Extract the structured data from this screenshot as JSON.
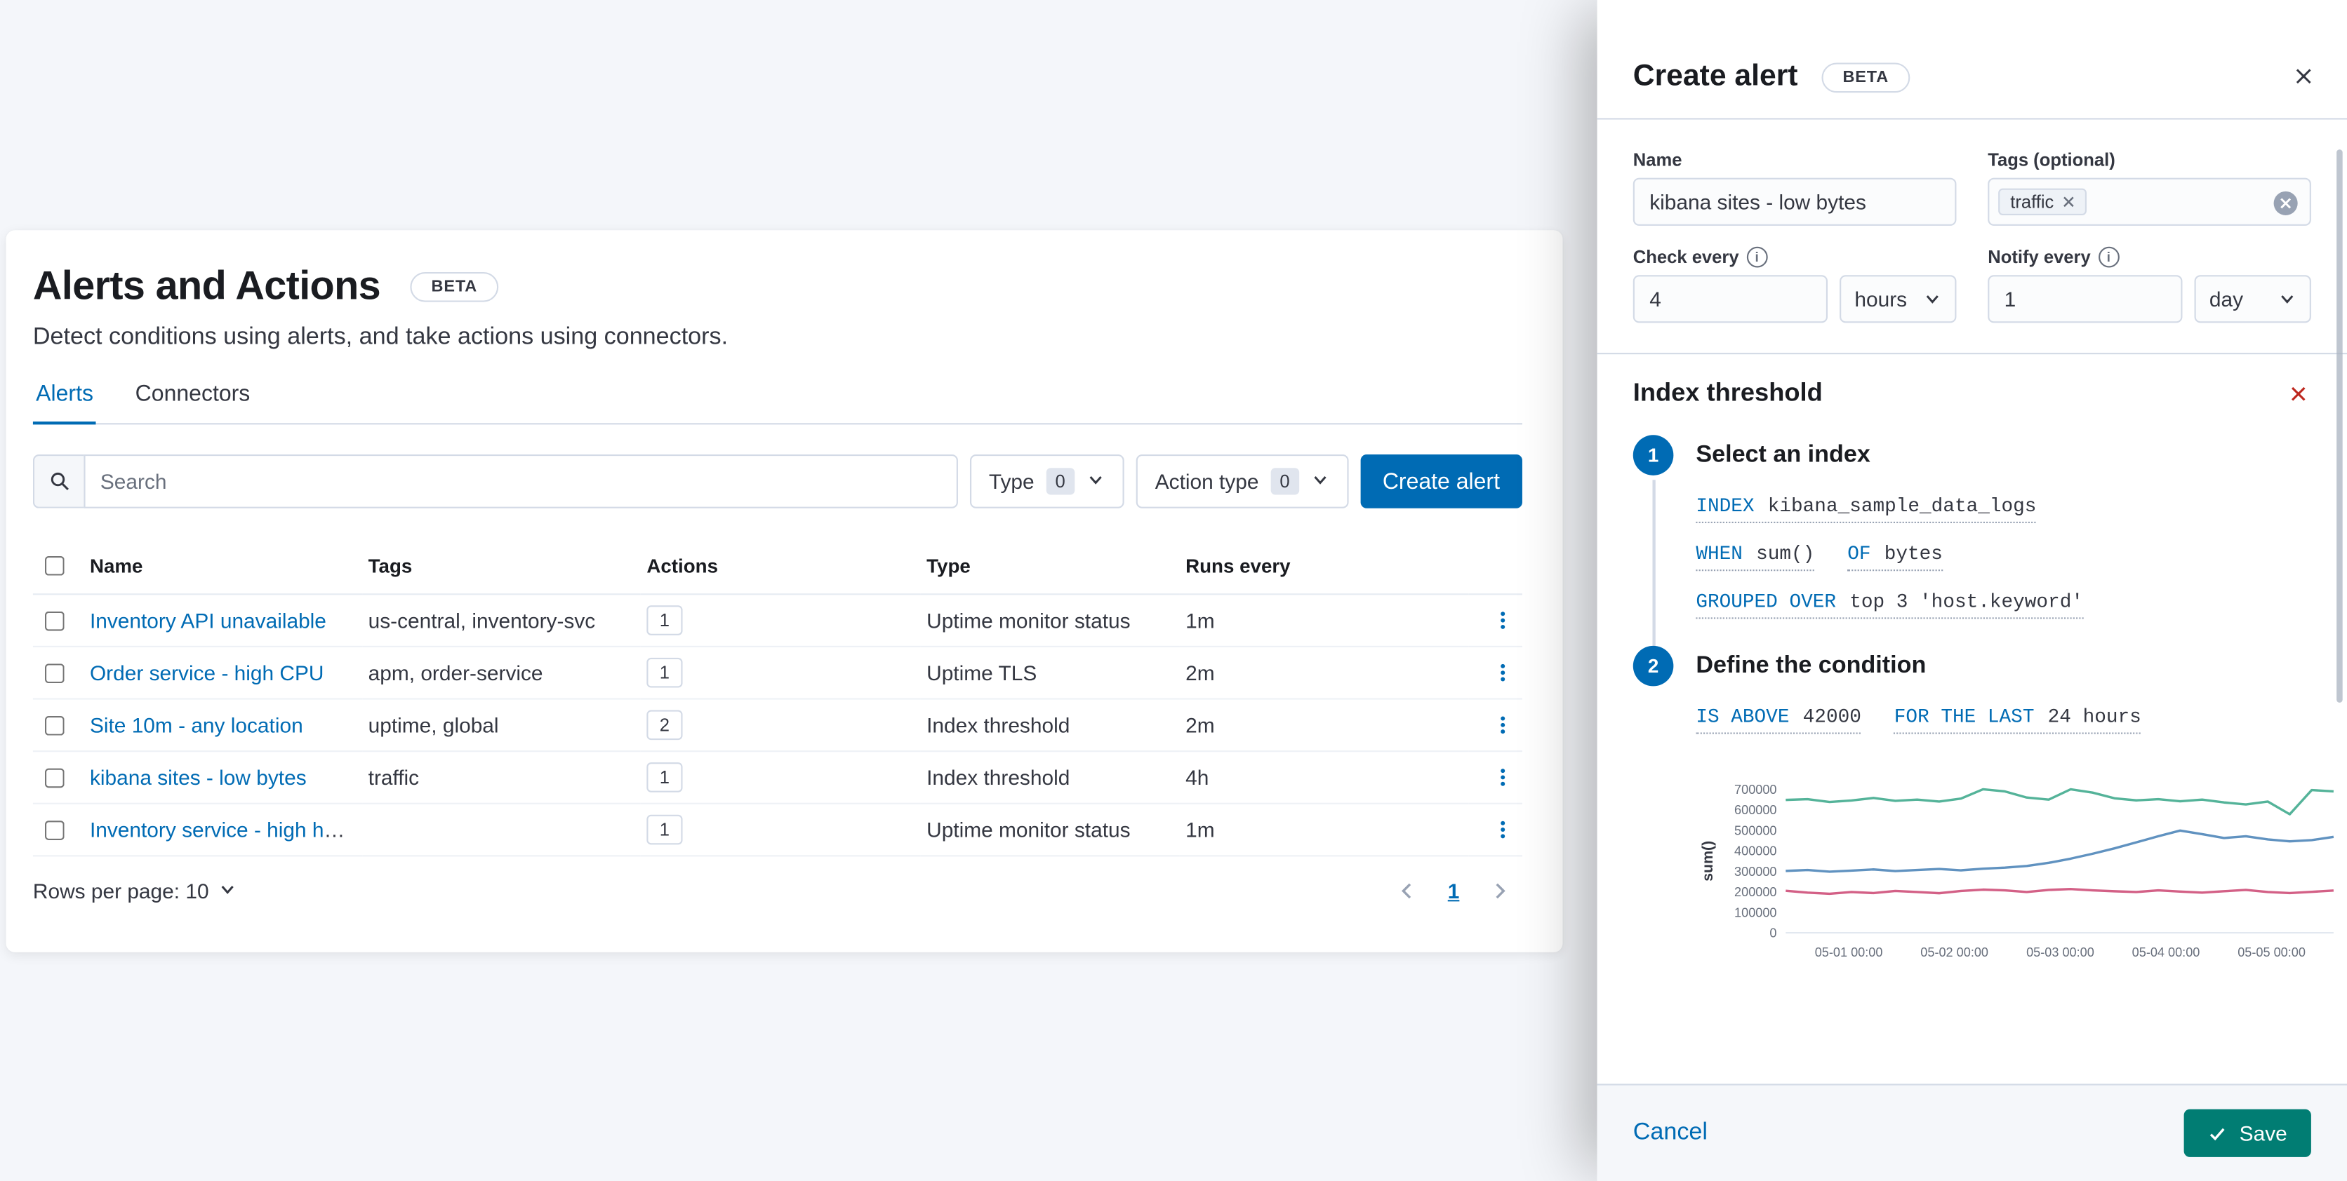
{
  "colors": {
    "primary": "#006BB4",
    "save_button": "#017D73",
    "danger": "#BD271E",
    "link": "#006BB4"
  },
  "page": {
    "title": "Alerts and Actions",
    "beta_badge": "BETA",
    "subtitle": "Detect conditions using alerts, and take actions using connectors.",
    "tabs": [
      {
        "label": "Alerts",
        "active": true
      },
      {
        "label": "Connectors",
        "active": false
      }
    ],
    "toolbar": {
      "search_placeholder": "Search",
      "filters": [
        {
          "label": "Type",
          "count": "0"
        },
        {
          "label": "Action type",
          "count": "0"
        }
      ],
      "create_button": "Create alert"
    },
    "table": {
      "headers": [
        "Name",
        "Tags",
        "Actions",
        "Type",
        "Runs every"
      ],
      "rows": [
        {
          "name": "Inventory API unavailable",
          "tags": "us-central, inventory-svc",
          "actions": "1",
          "type": "Uptime monitor status",
          "runs_every": "1m"
        },
        {
          "name": "Order service - high CPU",
          "tags": "apm, order-service",
          "actions": "1",
          "type": "Uptime TLS",
          "runs_every": "2m"
        },
        {
          "name": "Site 10m - any location",
          "tags": "uptime, global",
          "actions": "2",
          "type": "Index threshold",
          "runs_every": "2m"
        },
        {
          "name": "kibana sites - low bytes",
          "tags": "traffic",
          "actions": "1",
          "type": "Index threshold",
          "runs_every": "4h"
        },
        {
          "name": "Inventory service - high heap",
          "tags": "",
          "actions": "1",
          "type": "Uptime monitor status",
          "runs_every": "1m"
        }
      ],
      "rows_per_page": "Rows per page: 10",
      "page_number": "1"
    }
  },
  "flyout": {
    "title": "Create alert",
    "beta_badge": "BETA",
    "fields": {
      "name_label": "Name",
      "name_value": "kibana sites - low bytes",
      "tags_label": "Tags (optional)",
      "tag_chip": "traffic",
      "check_every_label": "Check every",
      "check_every_value": "4",
      "check_every_unit": "hours",
      "notify_every_label": "Notify every",
      "notify_every_value": "1",
      "notify_every_unit": "day"
    },
    "alert_type": {
      "title": "Index threshold",
      "steps": [
        {
          "number": "1",
          "title": "Select an index"
        },
        {
          "number": "2",
          "title": "Define the condition"
        }
      ],
      "expressions": {
        "index_label": "INDEX",
        "index_value": "kibana_sample_data_logs",
        "when_label": "WHEN",
        "when_value": "sum()",
        "of_label": "OF",
        "of_value": "bytes",
        "grouped_label": "GROUPED OVER",
        "grouped_value": "top 3 'host.keyword'",
        "threshold_label": "IS ABOVE",
        "threshold_value": "42000",
        "window_label": "FOR THE LAST",
        "window_value": "24 hours"
      }
    },
    "footer": {
      "cancel": "Cancel",
      "save": "Save"
    }
  },
  "chart_data": {
    "type": "line",
    "title": "",
    "ylabel": "sum()",
    "xlabel": "",
    "ylim": [
      0,
      700000
    ],
    "yticks": [
      0,
      100000,
      200000,
      300000,
      400000,
      500000,
      600000,
      700000
    ],
    "xticks": [
      "05-01 00:00",
      "05-02 00:00",
      "05-03 00:00",
      "05-04 00:00",
      "05-05 00:00"
    ],
    "legend": false,
    "grid": false,
    "series": [
      {
        "name": "series-1",
        "color": "#54B399",
        "values": [
          648000,
          652000,
          638000,
          645000,
          658000,
          644000,
          650000,
          640000,
          655000,
          700000,
          690000,
          660000,
          650000,
          700000,
          684000,
          656000,
          646000,
          652000,
          642000,
          650000,
          636000,
          626000,
          640000,
          578000,
          696000,
          690000
        ]
      },
      {
        "name": "series-2",
        "color": "#6092C0",
        "values": [
          302000,
          306000,
          298000,
          303000,
          309000,
          301000,
          306000,
          311000,
          305000,
          313000,
          318000,
          326000,
          341000,
          362000,
          386000,
          412000,
          441000,
          471000,
          499000,
          481000,
          462000,
          471000,
          456000,
          446000,
          452000,
          468000
        ]
      },
      {
        "name": "series-3",
        "color": "#D36086",
        "values": [
          205000,
          196000,
          190000,
          199000,
          194000,
          204000,
          199000,
          193000,
          204000,
          211000,
          207000,
          199000,
          209000,
          214000,
          207000,
          203000,
          199000,
          207000,
          201000,
          196000,
          203000,
          209000,
          199000,
          194000,
          200000,
          206000
        ]
      }
    ]
  }
}
